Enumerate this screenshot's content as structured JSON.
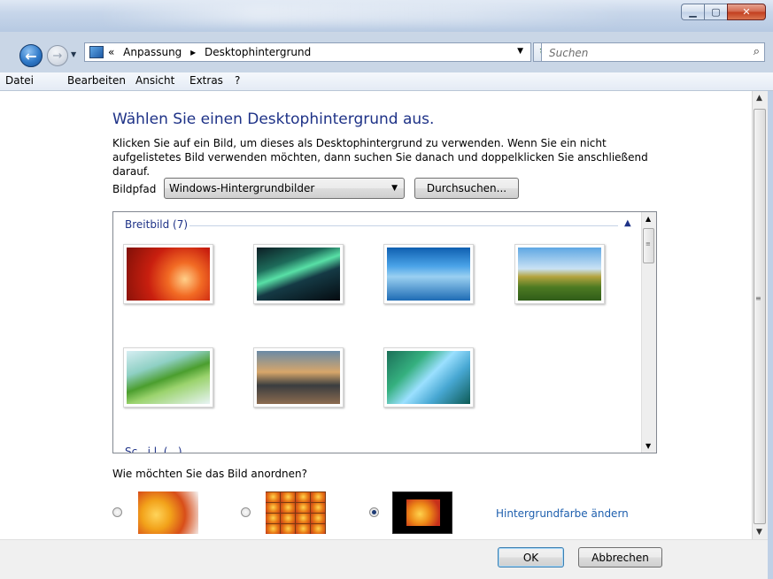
{
  "window": {
    "minimize_icon": "minimize-icon",
    "maximize_icon": "maximize-icon",
    "close_icon": "close-icon"
  },
  "nav": {
    "back_icon": "back-arrow-icon",
    "forward_icon": "forward-arrow-icon",
    "breadcrumb_prefix": "«",
    "breadcrumb": [
      "Anpassung",
      "Desktophintergrund"
    ],
    "search_placeholder": "Suchen"
  },
  "menu": {
    "items": [
      "Datei",
      "Bearbeiten",
      "Ansicht",
      "Extras",
      "?"
    ]
  },
  "content": {
    "heading": "Wählen Sie einen Desktophintergrund aus.",
    "description": "Klicken Sie auf ein Bild, um dieses als Desktophintergrund zu verwenden. Wenn Sie ein nicht aufgelistetes Bild verwenden möchten, dann suchen Sie danach und doppelklicken Sie anschließend darauf.",
    "bildpfad_label": "Bildpfad",
    "bildpfad_value": "Windows-Hintergrundbilder",
    "browse_label": "Durchsuchen...",
    "group_label": "Breitbild (7)",
    "next_group_partial": "Sc...i.l. (...)",
    "thumbnails": [
      "flower-red",
      "aurora",
      "fish-school",
      "landscape-hills",
      "palm-leaf",
      "mountain-lake",
      "green-waves"
    ],
    "arrange_label": "Wie möchten Sie das Bild anordnen?",
    "arrange_options": [
      {
        "name": "stretch",
        "selected": false
      },
      {
        "name": "tile",
        "selected": false
      },
      {
        "name": "center",
        "selected": true
      }
    ],
    "color_link": "Hintergrundfarbe ändern"
  },
  "footer": {
    "ok_label": "OK",
    "cancel_label": "Abbrechen"
  },
  "colors": {
    "heading": "#1e3287",
    "link": "#1e5fae"
  }
}
